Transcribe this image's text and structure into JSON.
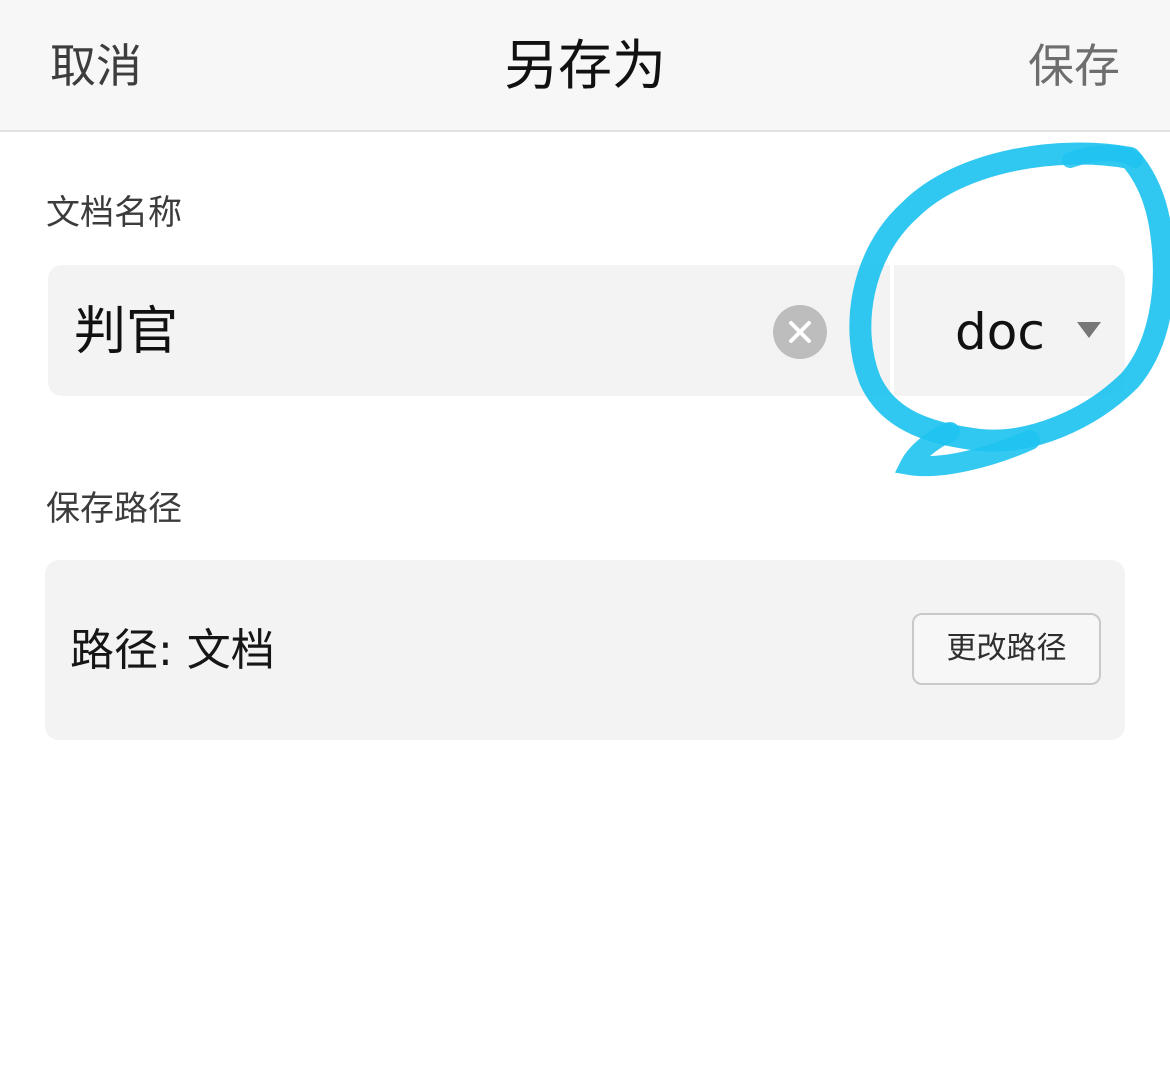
{
  "navbar": {
    "cancel_label": "取消",
    "title": "另存为",
    "save_label": "保存"
  },
  "name_section": {
    "label": "文档名称",
    "value": "判官",
    "clear_icon": "clear-circle-icon",
    "format_value": "doc",
    "format_caret_icon": "caret-down-icon"
  },
  "annotation": {
    "type": "hand-drawn circle",
    "color": "#1ec3f0"
  },
  "path_section": {
    "label": "保存路径",
    "path_text": "路径: 文档",
    "change_button_label": "更改路径"
  },
  "colors": {
    "navbar_bg": "#f7f7f7",
    "field_bg": "#f3f3f3",
    "clear_button_bg": "#bdbdbd",
    "annotation": "#1ec3f0"
  }
}
